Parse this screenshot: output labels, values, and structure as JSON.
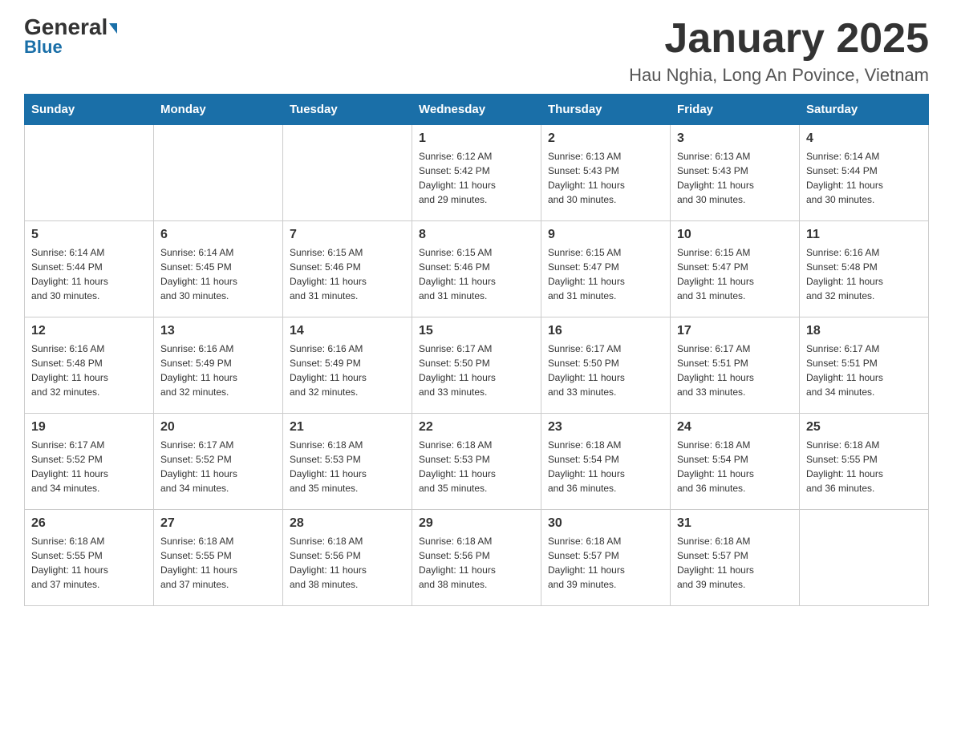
{
  "header": {
    "logo_main": "General",
    "logo_sub": "Blue",
    "title": "January 2025",
    "location": "Hau Nghia, Long An Povince, Vietnam"
  },
  "days_of_week": [
    "Sunday",
    "Monday",
    "Tuesday",
    "Wednesday",
    "Thursday",
    "Friday",
    "Saturday"
  ],
  "weeks": [
    [
      {
        "day": "",
        "info": ""
      },
      {
        "day": "",
        "info": ""
      },
      {
        "day": "",
        "info": ""
      },
      {
        "day": "1",
        "info": "Sunrise: 6:12 AM\nSunset: 5:42 PM\nDaylight: 11 hours\nand 29 minutes."
      },
      {
        "day": "2",
        "info": "Sunrise: 6:13 AM\nSunset: 5:43 PM\nDaylight: 11 hours\nand 30 minutes."
      },
      {
        "day": "3",
        "info": "Sunrise: 6:13 AM\nSunset: 5:43 PM\nDaylight: 11 hours\nand 30 minutes."
      },
      {
        "day": "4",
        "info": "Sunrise: 6:14 AM\nSunset: 5:44 PM\nDaylight: 11 hours\nand 30 minutes."
      }
    ],
    [
      {
        "day": "5",
        "info": "Sunrise: 6:14 AM\nSunset: 5:44 PM\nDaylight: 11 hours\nand 30 minutes."
      },
      {
        "day": "6",
        "info": "Sunrise: 6:14 AM\nSunset: 5:45 PM\nDaylight: 11 hours\nand 30 minutes."
      },
      {
        "day": "7",
        "info": "Sunrise: 6:15 AM\nSunset: 5:46 PM\nDaylight: 11 hours\nand 31 minutes."
      },
      {
        "day": "8",
        "info": "Sunrise: 6:15 AM\nSunset: 5:46 PM\nDaylight: 11 hours\nand 31 minutes."
      },
      {
        "day": "9",
        "info": "Sunrise: 6:15 AM\nSunset: 5:47 PM\nDaylight: 11 hours\nand 31 minutes."
      },
      {
        "day": "10",
        "info": "Sunrise: 6:15 AM\nSunset: 5:47 PM\nDaylight: 11 hours\nand 31 minutes."
      },
      {
        "day": "11",
        "info": "Sunrise: 6:16 AM\nSunset: 5:48 PM\nDaylight: 11 hours\nand 32 minutes."
      }
    ],
    [
      {
        "day": "12",
        "info": "Sunrise: 6:16 AM\nSunset: 5:48 PM\nDaylight: 11 hours\nand 32 minutes."
      },
      {
        "day": "13",
        "info": "Sunrise: 6:16 AM\nSunset: 5:49 PM\nDaylight: 11 hours\nand 32 minutes."
      },
      {
        "day": "14",
        "info": "Sunrise: 6:16 AM\nSunset: 5:49 PM\nDaylight: 11 hours\nand 32 minutes."
      },
      {
        "day": "15",
        "info": "Sunrise: 6:17 AM\nSunset: 5:50 PM\nDaylight: 11 hours\nand 33 minutes."
      },
      {
        "day": "16",
        "info": "Sunrise: 6:17 AM\nSunset: 5:50 PM\nDaylight: 11 hours\nand 33 minutes."
      },
      {
        "day": "17",
        "info": "Sunrise: 6:17 AM\nSunset: 5:51 PM\nDaylight: 11 hours\nand 33 minutes."
      },
      {
        "day": "18",
        "info": "Sunrise: 6:17 AM\nSunset: 5:51 PM\nDaylight: 11 hours\nand 34 minutes."
      }
    ],
    [
      {
        "day": "19",
        "info": "Sunrise: 6:17 AM\nSunset: 5:52 PM\nDaylight: 11 hours\nand 34 minutes."
      },
      {
        "day": "20",
        "info": "Sunrise: 6:17 AM\nSunset: 5:52 PM\nDaylight: 11 hours\nand 34 minutes."
      },
      {
        "day": "21",
        "info": "Sunrise: 6:18 AM\nSunset: 5:53 PM\nDaylight: 11 hours\nand 35 minutes."
      },
      {
        "day": "22",
        "info": "Sunrise: 6:18 AM\nSunset: 5:53 PM\nDaylight: 11 hours\nand 35 minutes."
      },
      {
        "day": "23",
        "info": "Sunrise: 6:18 AM\nSunset: 5:54 PM\nDaylight: 11 hours\nand 36 minutes."
      },
      {
        "day": "24",
        "info": "Sunrise: 6:18 AM\nSunset: 5:54 PM\nDaylight: 11 hours\nand 36 minutes."
      },
      {
        "day": "25",
        "info": "Sunrise: 6:18 AM\nSunset: 5:55 PM\nDaylight: 11 hours\nand 36 minutes."
      }
    ],
    [
      {
        "day": "26",
        "info": "Sunrise: 6:18 AM\nSunset: 5:55 PM\nDaylight: 11 hours\nand 37 minutes."
      },
      {
        "day": "27",
        "info": "Sunrise: 6:18 AM\nSunset: 5:55 PM\nDaylight: 11 hours\nand 37 minutes."
      },
      {
        "day": "28",
        "info": "Sunrise: 6:18 AM\nSunset: 5:56 PM\nDaylight: 11 hours\nand 38 minutes."
      },
      {
        "day": "29",
        "info": "Sunrise: 6:18 AM\nSunset: 5:56 PM\nDaylight: 11 hours\nand 38 minutes."
      },
      {
        "day": "30",
        "info": "Sunrise: 6:18 AM\nSunset: 5:57 PM\nDaylight: 11 hours\nand 39 minutes."
      },
      {
        "day": "31",
        "info": "Sunrise: 6:18 AM\nSunset: 5:57 PM\nDaylight: 11 hours\nand 39 minutes."
      },
      {
        "day": "",
        "info": ""
      }
    ]
  ]
}
